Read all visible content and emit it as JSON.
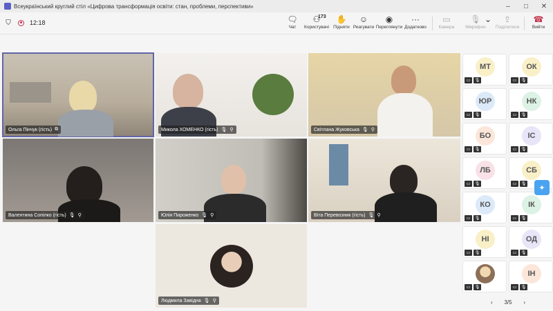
{
  "window": {
    "title": "Всеукраїнський круглий стіл «Цифрова трансформація освіти: стан, проблеми, перспективи»"
  },
  "toolbar": {
    "timer": "12:18",
    "chat_label": "Чат",
    "people_label": "Користувачі",
    "people_count": "173",
    "raise_label": "Підняти",
    "react_label": "Реагувати",
    "view_label": "Переглянути",
    "more_label": "Додатково",
    "camera_label": "Камера",
    "mic_label": "Мікрофон",
    "share_label": "Поділитися",
    "leave_label": "Вийти"
  },
  "tiles": [
    {
      "name": "Ольга Пінчук (гість)"
    },
    {
      "name": "Микола ХОМЕНКО (гість)"
    },
    {
      "name": "Світлана Жуковська"
    },
    {
      "name": "Валентина Сопілко (гість)"
    },
    {
      "name": "Юлія Пироженко"
    },
    {
      "name": "Віта Перевозник (гість)"
    },
    {
      "name": "Людмила Завідна"
    }
  ],
  "sidebar": {
    "avatars": [
      {
        "initials": "МТ",
        "color": "#f9f0c8"
      },
      {
        "initials": "ОК",
        "color": "#f9f0c8"
      },
      {
        "initials": "ЮР",
        "color": "#dbe9f9"
      },
      {
        "initials": "НК",
        "color": "#dcf2e4"
      },
      {
        "initials": "БО",
        "color": "#fbe6d9"
      },
      {
        "initials": "ІС",
        "color": "#e7e5f7"
      },
      {
        "initials": "ЛБ",
        "color": "#f8e1e7"
      },
      {
        "initials": "СБ",
        "color": "#f9f0c8"
      },
      {
        "initials": "КО",
        "color": "#dbe9f9"
      },
      {
        "initials": "ІК",
        "color": "#dcf2e4"
      },
      {
        "initials": "НІ",
        "color": "#f9f0c8"
      },
      {
        "initials": "ОД",
        "color": "#e7e5f7"
      },
      {
        "initials": "",
        "color": "#d9c7b4"
      },
      {
        "initials": "ІН",
        "color": "#fbe6d9"
      }
    ],
    "page": "3/5"
  }
}
